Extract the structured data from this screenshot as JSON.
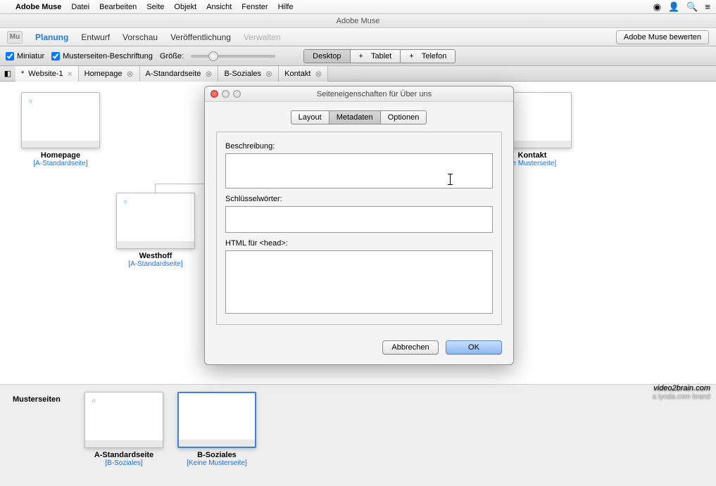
{
  "mac_menu": {
    "app": "Adobe Muse",
    "items": [
      "Datei",
      "Bearbeiten",
      "Seite",
      "Objekt",
      "Ansicht",
      "Fenster",
      "Hilfe"
    ],
    "right_icons": [
      "cc-icon",
      "user-icon",
      "search-icon",
      "list-icon"
    ]
  },
  "app_title": "Adobe Muse",
  "nav": {
    "items": [
      {
        "label": "Planung",
        "state": "active"
      },
      {
        "label": "Entwurf",
        "state": "normal"
      },
      {
        "label": "Vorschau",
        "state": "normal"
      },
      {
        "label": "Veröffentlichung",
        "state": "normal"
      },
      {
        "label": "Verwalten",
        "state": "disabled"
      }
    ],
    "evaluate_btn": "Adobe Muse bewerten"
  },
  "controls": {
    "miniatur": "Miniatur",
    "masterbeschriftung": "Musterseiten-Beschriftung",
    "size_label": "Größe:",
    "devices": [
      {
        "label": "Desktop",
        "active": true,
        "prefix": ""
      },
      {
        "label": "Tablet",
        "active": false,
        "prefix": "+"
      },
      {
        "label": "Telefon",
        "active": false,
        "prefix": "+"
      }
    ]
  },
  "tabs": [
    {
      "label": "Website-1",
      "active": true,
      "prefix": "*"
    },
    {
      "label": "Homepage",
      "active": false
    },
    {
      "label": "A-Standardseite",
      "active": false
    },
    {
      "label": "B-Soziales",
      "active": false
    },
    {
      "label": "Kontakt",
      "active": false
    }
  ],
  "pages": {
    "homepage": {
      "name": "Homepage",
      "master": "[A-Standardseite]"
    },
    "westhoff": {
      "name": "Westhoff",
      "master": "[A-Standardseite]"
    },
    "kontakt": {
      "name": "Kontakt",
      "master": "ne Musterseite]"
    }
  },
  "master": {
    "section_label": "Musterseiten",
    "a": {
      "name": "A-Standardseite",
      "master": "[B-Soziales]"
    },
    "b": {
      "name": "B-Soziales",
      "master": "[Keine Musterseite]"
    }
  },
  "dialog": {
    "title": "Seiteneigenschaften für Über uns",
    "tabs": [
      {
        "label": "Layout",
        "active": false
      },
      {
        "label": "Metadaten",
        "active": true
      },
      {
        "label": "Optionen",
        "active": false
      }
    ],
    "fields": {
      "beschreibung_label": "Beschreibung:",
      "beschreibung_value": "",
      "keywords_label": "Schlüsselwörter:",
      "keywords_value": "",
      "head_label": "HTML für <head>:",
      "head_value": ""
    },
    "buttons": {
      "cancel": "Abbrechen",
      "ok": "OK"
    }
  },
  "watermark": {
    "main": "video2brain.com",
    "sub": "a lynda.com brand"
  }
}
